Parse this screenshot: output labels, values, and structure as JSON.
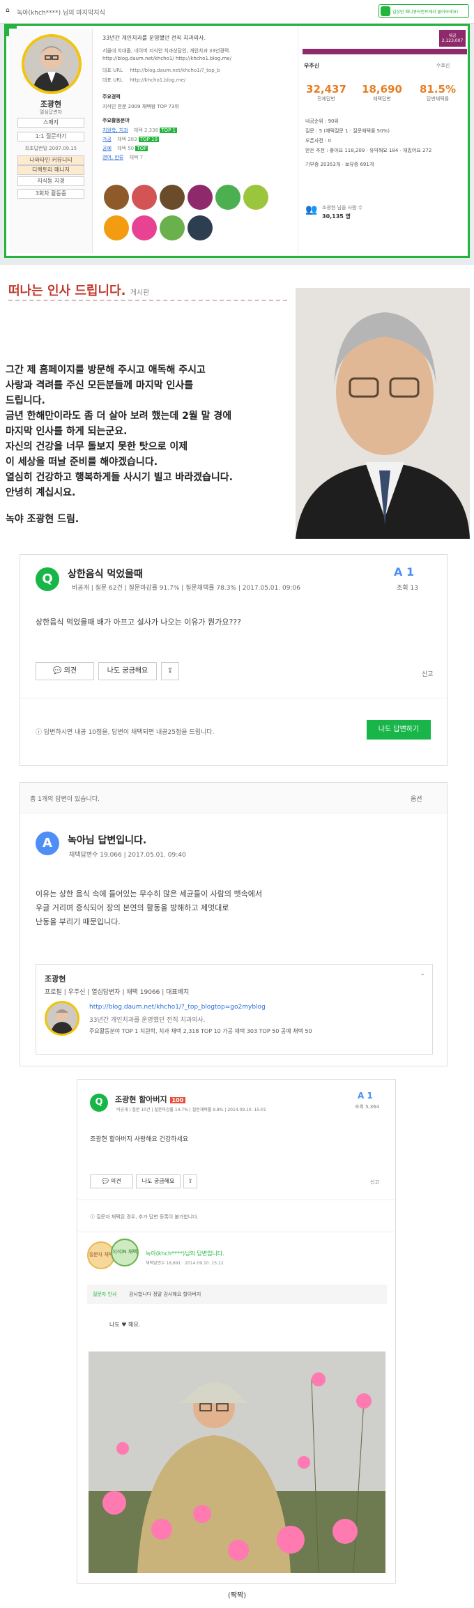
{
  "top": {
    "home_icon": "home-icon",
    "breadcrumb": "녹아(khch****) 님의 마지막지식",
    "banner": "김상민 매니큐어먼트에서 물어보세요!"
  },
  "profile": {
    "name": "조광현",
    "subtitle": "열심답변자",
    "level_btn": "스패지",
    "follow_btn": "1:1 질문하기",
    "joined": "최초답변일 2007.09.15",
    "menu": [
      "나와타인 커뮤니티",
      "디렉토리 매니저",
      "지식동 지경",
      "3회차 활동중"
    ],
    "intro": "33년간 개인치과를 운영했던 전직 치과의사.",
    "intro2": "서울대 치대졸, 네이버 지식인 치과상담인, 개인치과 33년경력.",
    "intro_url": "http://blog.daum.net/khcho1/ http://khcho1.blog.me/",
    "url1_label": "대표 URL",
    "url1": "http://blog.daum.net/khcho1/?_top_b",
    "url2_label": "대표 URL",
    "url2": "http://khcho1.blog.me/",
    "main_exp_label": "주요경력",
    "main_exp": "지식인 전문 2009 채택왕 TOP 73위",
    "main_field_label": "주요활동분야",
    "fields": [
      {
        "name": "치원학, 치과",
        "count": "채택 2,338",
        "tag": "TOP 1"
      },
      {
        "name": "가공",
        "count": "채택 283",
        "tag": "TOP 10"
      },
      {
        "name": "공예",
        "count": "채택 50",
        "tag": "TOP"
      },
      {
        "name": "영어, 한류",
        "count": "채택 7",
        "tag": ""
      }
    ],
    "grade_label": "우주신",
    "grade_box": "내공 2,123,007",
    "follow_label": "수호신",
    "stats": [
      {
        "num": "32,437",
        "label": "전체답변"
      },
      {
        "num": "18,690",
        "label": "채택답변"
      },
      {
        "num": "81.5%",
        "label": "답변채택률"
      }
    ],
    "details": [
      "내공순위 : 90위",
      "질문 : 5 (채택질문 1 · 질문채택률 50%)",
      "오픈사전 : 0",
      "받은 추천 : 좋아요 118,209 · 유익해요 184 · 재밌어요 272"
    ],
    "donation": "기부중 20353개 · 보유중 691개",
    "fans_label": "조광현 님을 사람 수",
    "fans": "30,135 명"
  },
  "blog": {
    "title": "떠나는 인사 드립니다.",
    "category": "게시판",
    "lines": [
      "그간 제 홈페이지를 방문해 주시고 애독해 주시고",
      "사랑과 격려를 주신 모든분들께 마지막 인사를",
      "드립니다.",
      "금년 한해만이라도 좀 더 살아 보려 했는데 2월 말 경에",
      "마지막 인사를 하게 되는군요.",
      "자신의 건강을 너무 돌보지 못한 탓으로 이제",
      "이 세상을 떠날 준비를 해야겠습니다.",
      "열심히 건강하고 행복하게들 사시기 빌고 바라겠습니다.",
      "안녕히 계십시요."
    ],
    "sign": "녹야 조광현 드림."
  },
  "q1": {
    "title": "상한음식 먹었을때",
    "meta_user": "비공개",
    "meta_rest": "| 질문 62건 | 질문마감률 91.7% | 질문채택률 78.3% | 2017.05.01. 09:06",
    "a_count": "A 1",
    "views": "조회 13",
    "body": "상한음식 먹었을때 배가 아프고 설사가 나오는 이유가 뭔가요???",
    "btn_opinion": "의견",
    "btn_curious": "나도 궁금해요",
    "report": "신고",
    "notice": "답변하시면 내공 10점을, 답변이 채택되면 내공25점을 드립니다.",
    "answer_btn": "나도 답변하기"
  },
  "a1": {
    "count_text": "총 1개의 답변이 있습니다.",
    "sort": "옵션",
    "author": "녹아님 답변입니다.",
    "meta": "채택답변수 19,066 | 2017.05.01. 09:40",
    "body": [
      "이유는 상한 음식 속에 들어있는 무수히 많은 세균들이 사람의 뱃속에서",
      "우글 거리며 증식되어 장의 본연의 활동을 방해하고 제멋대로",
      "난동을 부리기 때문입니다."
    ],
    "card_name": "조광현",
    "card_tags": "프로필 | 우주신 | 열심답변자 | 채택 19066 | 대표배지",
    "card_url": "http://blog.daum.net/khcho1/?_top_blogtop=go2myblog",
    "card_intro": "33년간 개인치과를 운영했던 전직 치과의사.",
    "card_fields": "주요활동분야 TOP 1 치원학, 치과  채택 2,318  TOP 10 가공 채택 303  TOP 50 공예 채택 50"
  },
  "q2": {
    "title": "조광현 할아버지",
    "tag": "100",
    "meta": "비공개 | 질문 10건 | 질문마감률 14.7% | 질문채택률 9.8% | 2014.09.10. 15:01",
    "a_count": "A 1",
    "views": "조회 5,364",
    "body": "조광현 할아버지 사랑해요 건강하세요",
    "btn_opinion": "의견",
    "btn_curious": "나도 궁금해요",
    "report": "신고",
    "notice": "질문자 채택된 경우, 추가 답변 등록이 불가합니다.",
    "badge1": "질문자 채택",
    "badge2": "지식iN 채택",
    "author": "녹아(khch****)님의 답변입니다.",
    "meta2": "채택답변수 18,891 · 2014.09.10. 15:12",
    "asker_label": "질문자 인사",
    "asker_msg": "감사합니다 정말 감사해요 할아버지",
    "answer": "나도 ♥ 해요."
  },
  "caption": "(짝짝)",
  "colors": {
    "green": "#18b548",
    "red": "#c0392b",
    "orange": "#e67e22",
    "blue": "#4f8ef7",
    "purple": "#8e2a6b"
  }
}
